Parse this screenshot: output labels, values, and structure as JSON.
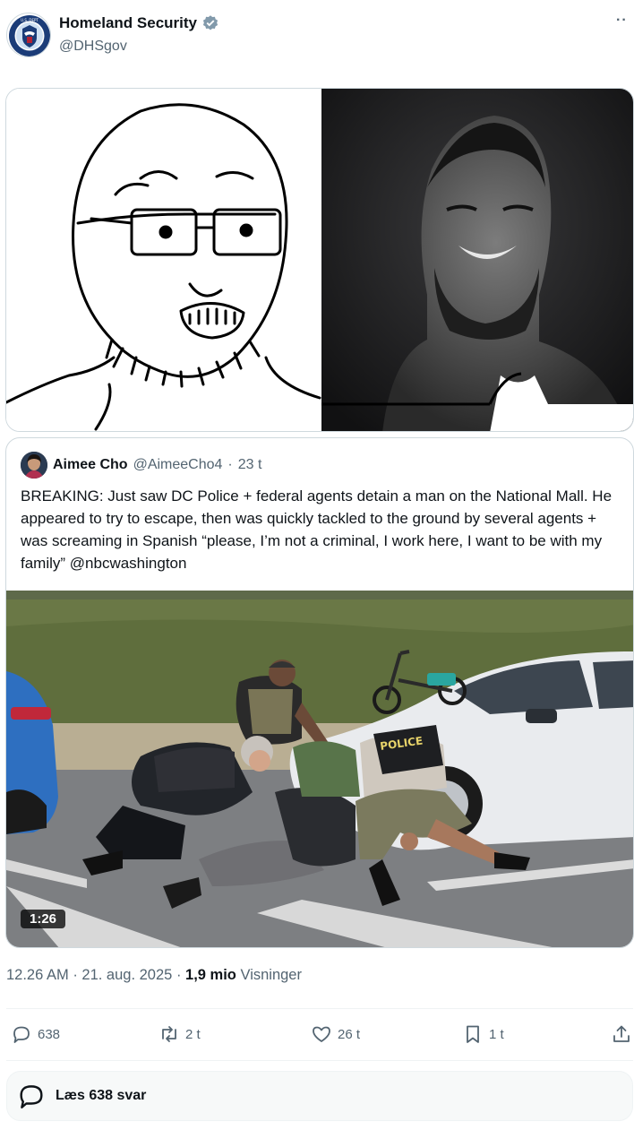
{
  "author": {
    "name": "Homeland Security",
    "handle": "@DHSgov",
    "verified_color": "#829aab",
    "avatar_icon": "dhs-seal-icon"
  },
  "quoted_post": {
    "name": "Aimee Cho",
    "handle": "@AimeeCho4",
    "separator": "·",
    "age": "23 t",
    "text": "BREAKING: Just saw DC Police + federal agents detain a man on the National Mall. He appeared to try to escape, then was quickly tackled to the ground by several agents + was screaming in Spanish “please, I’m not a criminal, I work here, I want to be with my family” @nbcwashington",
    "video_duration": "1:26",
    "police_label": "POLICE"
  },
  "meta": {
    "time": "12.26 AM",
    "date": "21. aug. 2025",
    "views_count": "1,9 mio",
    "views_label": "Visninger"
  },
  "actions": {
    "replies": "638",
    "reposts": "2 t",
    "likes": "26 t",
    "bookmarks": "1 t"
  },
  "reply_prompt": "Læs 638 svar",
  "colors": {
    "text_primary": "#0f1419",
    "text_secondary": "#536471",
    "border": "#cfd9de"
  }
}
